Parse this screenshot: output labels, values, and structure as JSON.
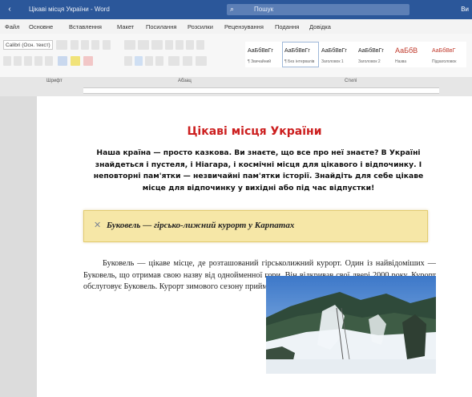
{
  "titlebar": {
    "title": "Цікаві місця України - Word",
    "search_placeholder": "Пошук",
    "account": "Ви"
  },
  "menu": {
    "tabs": [
      "Файл",
      "Основне",
      "Вставлення",
      "Макет",
      "Посилання",
      "Розсилки",
      "Рецензування",
      "Подання",
      "Довідка"
    ]
  },
  "ribbon": {
    "font_name": "Calibri (Осн. текст)",
    "styles": [
      {
        "sample": "АаБбВвГг",
        "caption": "¶ Звичайний"
      },
      {
        "sample": "АаБбВвГг",
        "caption": "¶ Без інтервалів"
      },
      {
        "sample": "АаБбВвГг",
        "caption": "Заголовок 1"
      },
      {
        "sample": "АаБбВвГг",
        "caption": "Заголовок 2"
      },
      {
        "sample": "АаБбВ",
        "caption": "Назва"
      },
      {
        "sample": "АаБбВвГ",
        "caption": "Підзаголовок"
      }
    ]
  },
  "ruler": {
    "labels": [
      "Шрифт",
      "Абзац",
      "Стилі"
    ]
  },
  "document": {
    "title": "Цікаві місця України",
    "intro": "Наша країна — просто казкова. Ви знаєте, що все про неї знаєте? В Україні знайдеться і пустеля, і Ніагара, і космічні місця для цікавого і відпочинку. І неповторні пам'ятки — незвичайні пам'ятки історії. Знайдіть для себе цікаве місце для відпочинку у вихідні або під час відпустки!",
    "callout": "Буковель — гірсько-лижний курорт у Карпатах",
    "body": "Буковель — цікаве місце, де розташований гірськолижний курорт. Один із найвідоміших — Буковель, що отримав свою назву від однойменної гори. Він відкривав свої двері 2000 року. Курорт обслуговує Буковель. Курорт зимового сезону приймає туристів. Багато схилів, трасу..."
  }
}
